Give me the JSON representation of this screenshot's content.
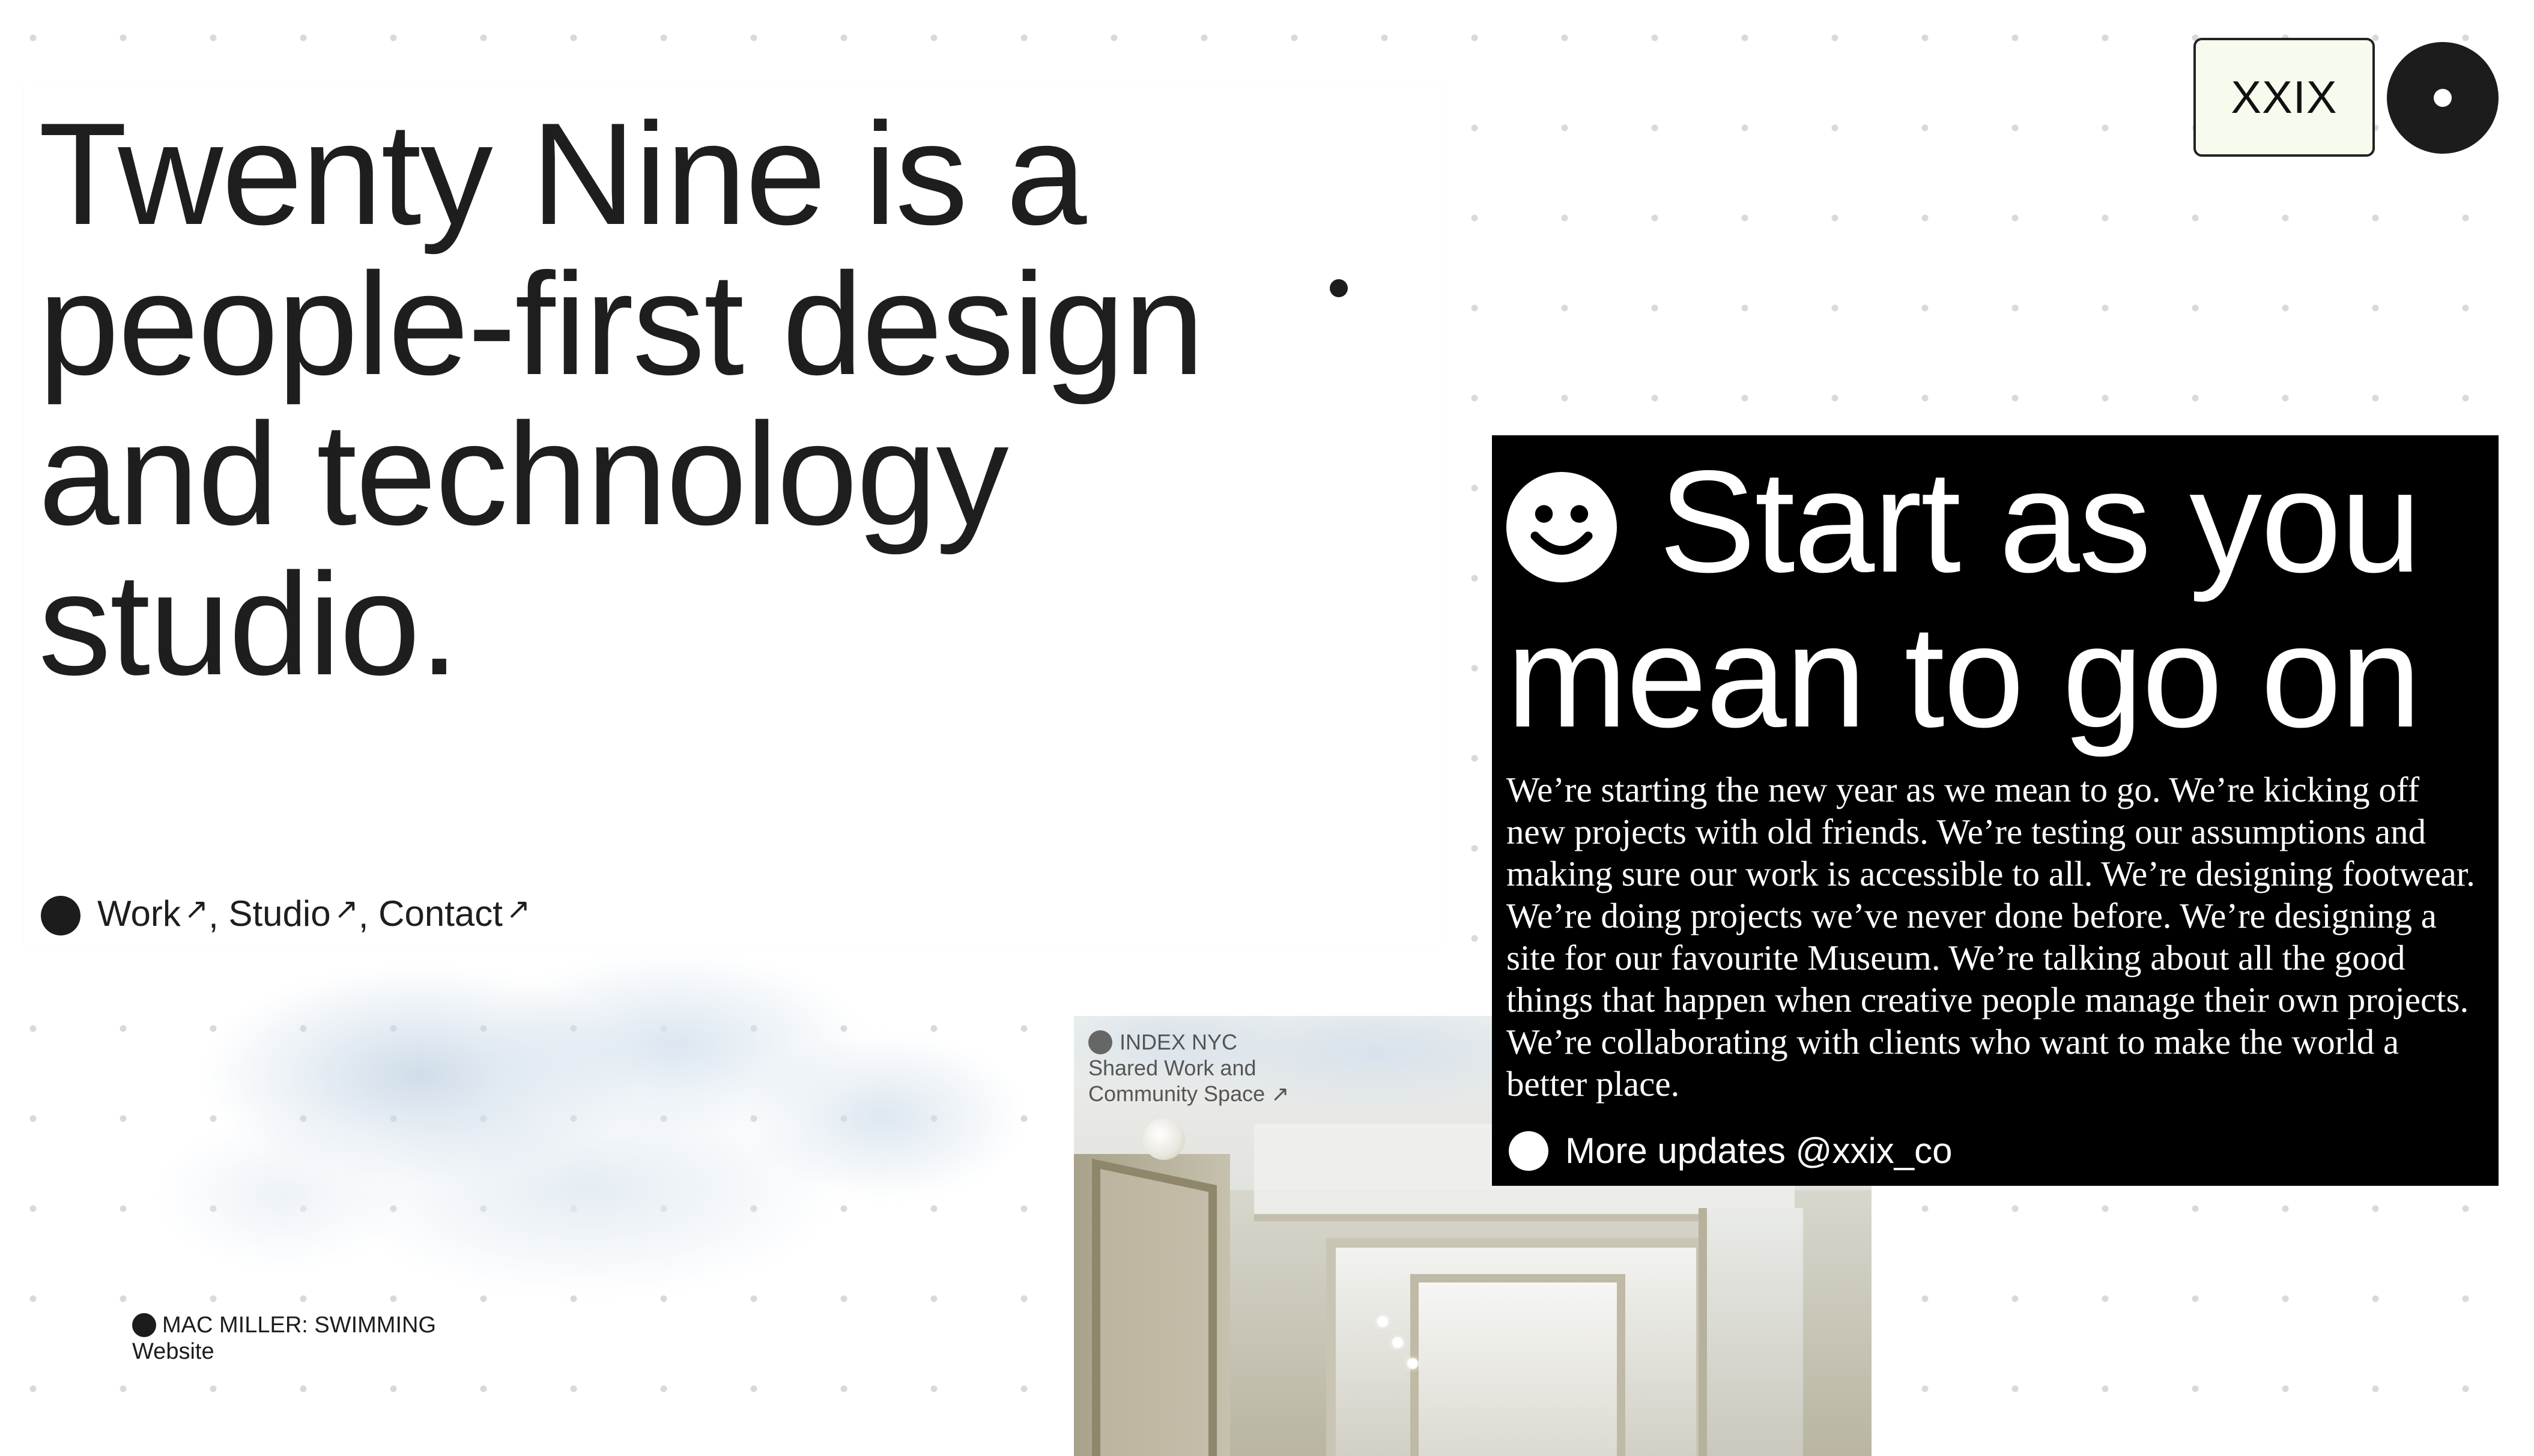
{
  "header": {
    "logo_button": "XXIX",
    "menu_button_icon": "menu-dot-icon"
  },
  "hero": {
    "title": "Twenty Nine is a people-first design and technology studio.",
    "nav": {
      "work": "Work",
      "studio": "Studio",
      "contact": "Contact",
      "arrow": "↗",
      "separator": ","
    }
  },
  "news": {
    "heading": "Start as you mean to go on",
    "heading_icon": "smiley-icon",
    "body": "We’re starting the new year as we mean to go. We’re kicking off new projects with old friends. We’re testing our assumptions and making sure our work is accessible to all. We’re designing footwear. We’re doing projects we’ve never done before. We’re designing a site for our favourite Museum. We’re talking about all the good things that happen when creative people manage their own projects. We’re collaborating with clients who want to make the world a better place.",
    "footer_link": "More updates @xxix_co"
  },
  "projects": [
    {
      "title": "MAC MILLER: SWIMMING",
      "subtitle": "Website"
    },
    {
      "title": "INDEX NYC",
      "subtitle_line1": "Shared Work and",
      "subtitle_line2": "Community Space",
      "arrow": "↗"
    }
  ],
  "colors": {
    "background": "#ffffff",
    "dot_grid": "#d9d9d9",
    "text": "#1c1c1c",
    "black_card": "#000000",
    "logo_button_bg": "#f6fbee"
  }
}
